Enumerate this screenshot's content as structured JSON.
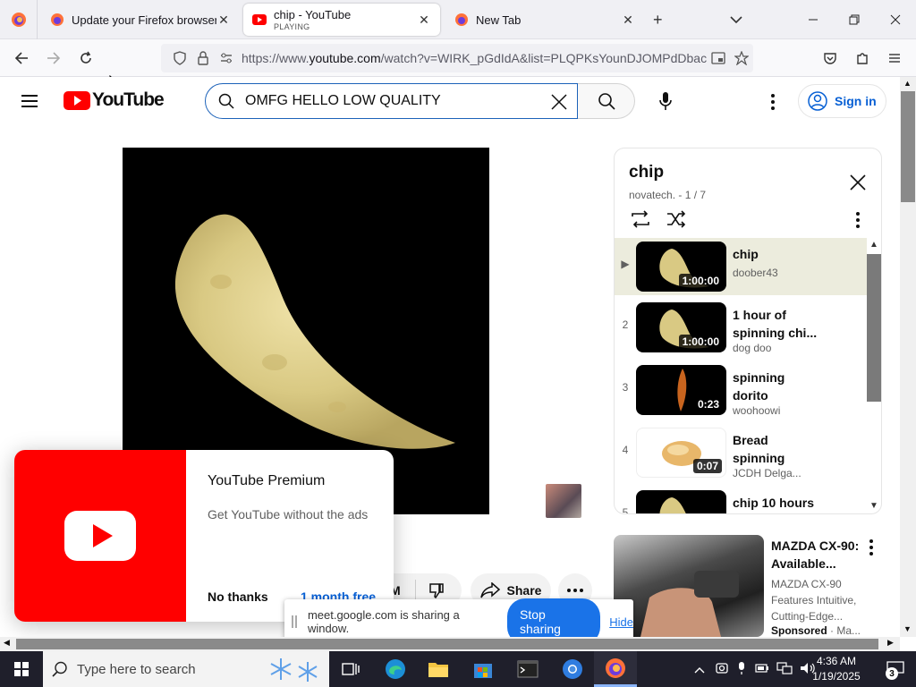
{
  "browser": {
    "tabs": [
      {
        "title": "Update your Firefox browser",
        "status": "",
        "active": false
      },
      {
        "title": "chip - YouTube",
        "status": "PLAYING",
        "active": true
      },
      {
        "title": "New Tab",
        "status": "",
        "active": false
      }
    ],
    "url_prefix": "https://www.",
    "url_domain": "youtube.com",
    "url_rest": "/watch?v=WIRK_pGdIdA&list=PLQPKsYounDJOMPdDbac"
  },
  "youtube": {
    "logo_text": "YouTube",
    "search_value": "OMFG HELLO LOW QUALITY",
    "sign_in": "Sign in"
  },
  "playlist": {
    "title": "chip",
    "subtitle": "novatech. - 1 / 7",
    "items": [
      {
        "index": "▶",
        "title": "chip",
        "channel": "doober43",
        "duration": "1:00:00"
      },
      {
        "index": "2",
        "title": "1 hour of spinning chi...",
        "channel": "dog doo",
        "duration": "1:00:00"
      },
      {
        "index": "3",
        "title": "spinning dorito",
        "channel": "woohoowi",
        "duration": "0:23"
      },
      {
        "index": "4",
        "title": "Bread spinning",
        "channel": "JCDH Delga...",
        "duration": "0:07"
      },
      {
        "index": "5",
        "title": "chip 10 hours",
        "channel": "",
        "duration": ""
      }
    ]
  },
  "ad": {
    "title": "MAZDA CX-90: Available...",
    "description": "MAZDA CX-90 Features Intuitive, Cutting-Edge...",
    "sponsored": "Sponsored",
    "advertiser": "· Ma..."
  },
  "premium": {
    "title": "YouTube Premium",
    "description": "Get YouTube without the ads",
    "no_thanks": "No thanks",
    "trial": "1 month free"
  },
  "actions": {
    "dislike_partial": "M",
    "share": "Share"
  },
  "sharing_bar": {
    "message": "meet.google.com is sharing a window.",
    "stop": "Stop sharing",
    "hide": "Hide"
  },
  "taskbar": {
    "search_placeholder": "Type here to search",
    "time": "4:36 AM",
    "date": "1/19/2025",
    "notification_count": "3"
  },
  "colors": {
    "youtube_red": "#ff0000",
    "link_blue": "#065fd4",
    "google_blue": "#1a73e8",
    "taskbar": "#1f1f2b"
  }
}
